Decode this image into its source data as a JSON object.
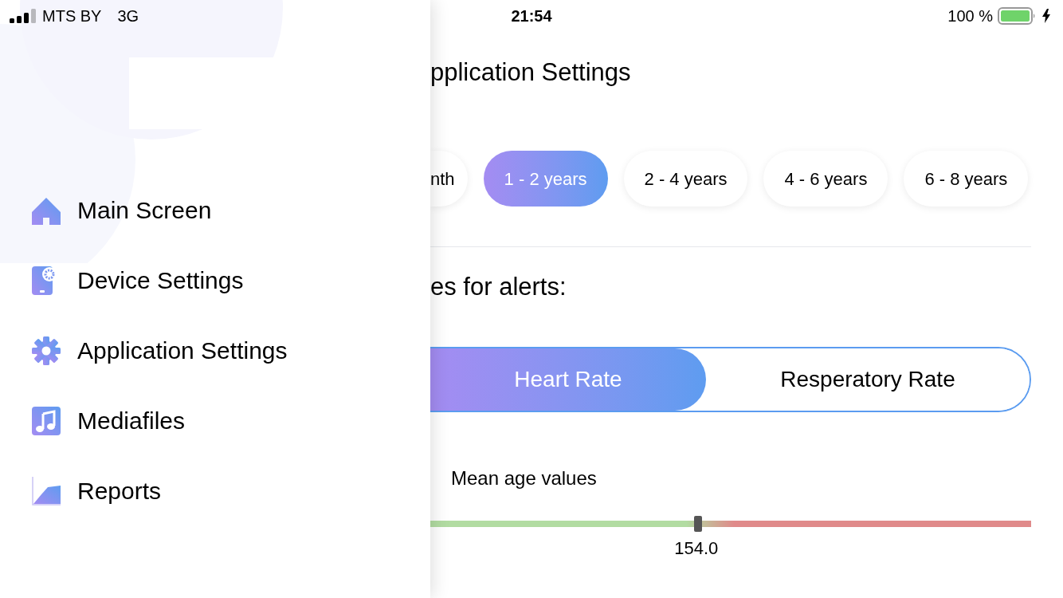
{
  "status_bar": {
    "carrier": "MTS BY",
    "network": "3G",
    "time": "21:54",
    "battery": "100 %"
  },
  "drawer": {
    "items": [
      {
        "kind": "home",
        "label": "Main Screen"
      },
      {
        "kind": "device",
        "label": "Device Settings"
      },
      {
        "kind": "gear",
        "label": "Application Settings"
      },
      {
        "kind": "music",
        "label": "Mediafiles"
      },
      {
        "kind": "chart",
        "label": "Reports"
      }
    ]
  },
  "main": {
    "title": "pplication Settings",
    "age_chips": [
      {
        "label": "nth",
        "selected": false
      },
      {
        "label": "1 - 2 years",
        "selected": true
      },
      {
        "label": "2 - 4 years",
        "selected": false
      },
      {
        "label": "4 - 6 years",
        "selected": false
      },
      {
        "label": "6 - 8 years",
        "selected": false
      }
    ],
    "alerts_heading": "es for alerts:",
    "tabs": [
      {
        "label": "Heart Rate",
        "selected": true
      },
      {
        "label": "Resperatory Rate",
        "selected": false
      }
    ],
    "slider": {
      "label": "Mean age values",
      "level": 0.446,
      "reading": "154.0"
    }
  }
}
